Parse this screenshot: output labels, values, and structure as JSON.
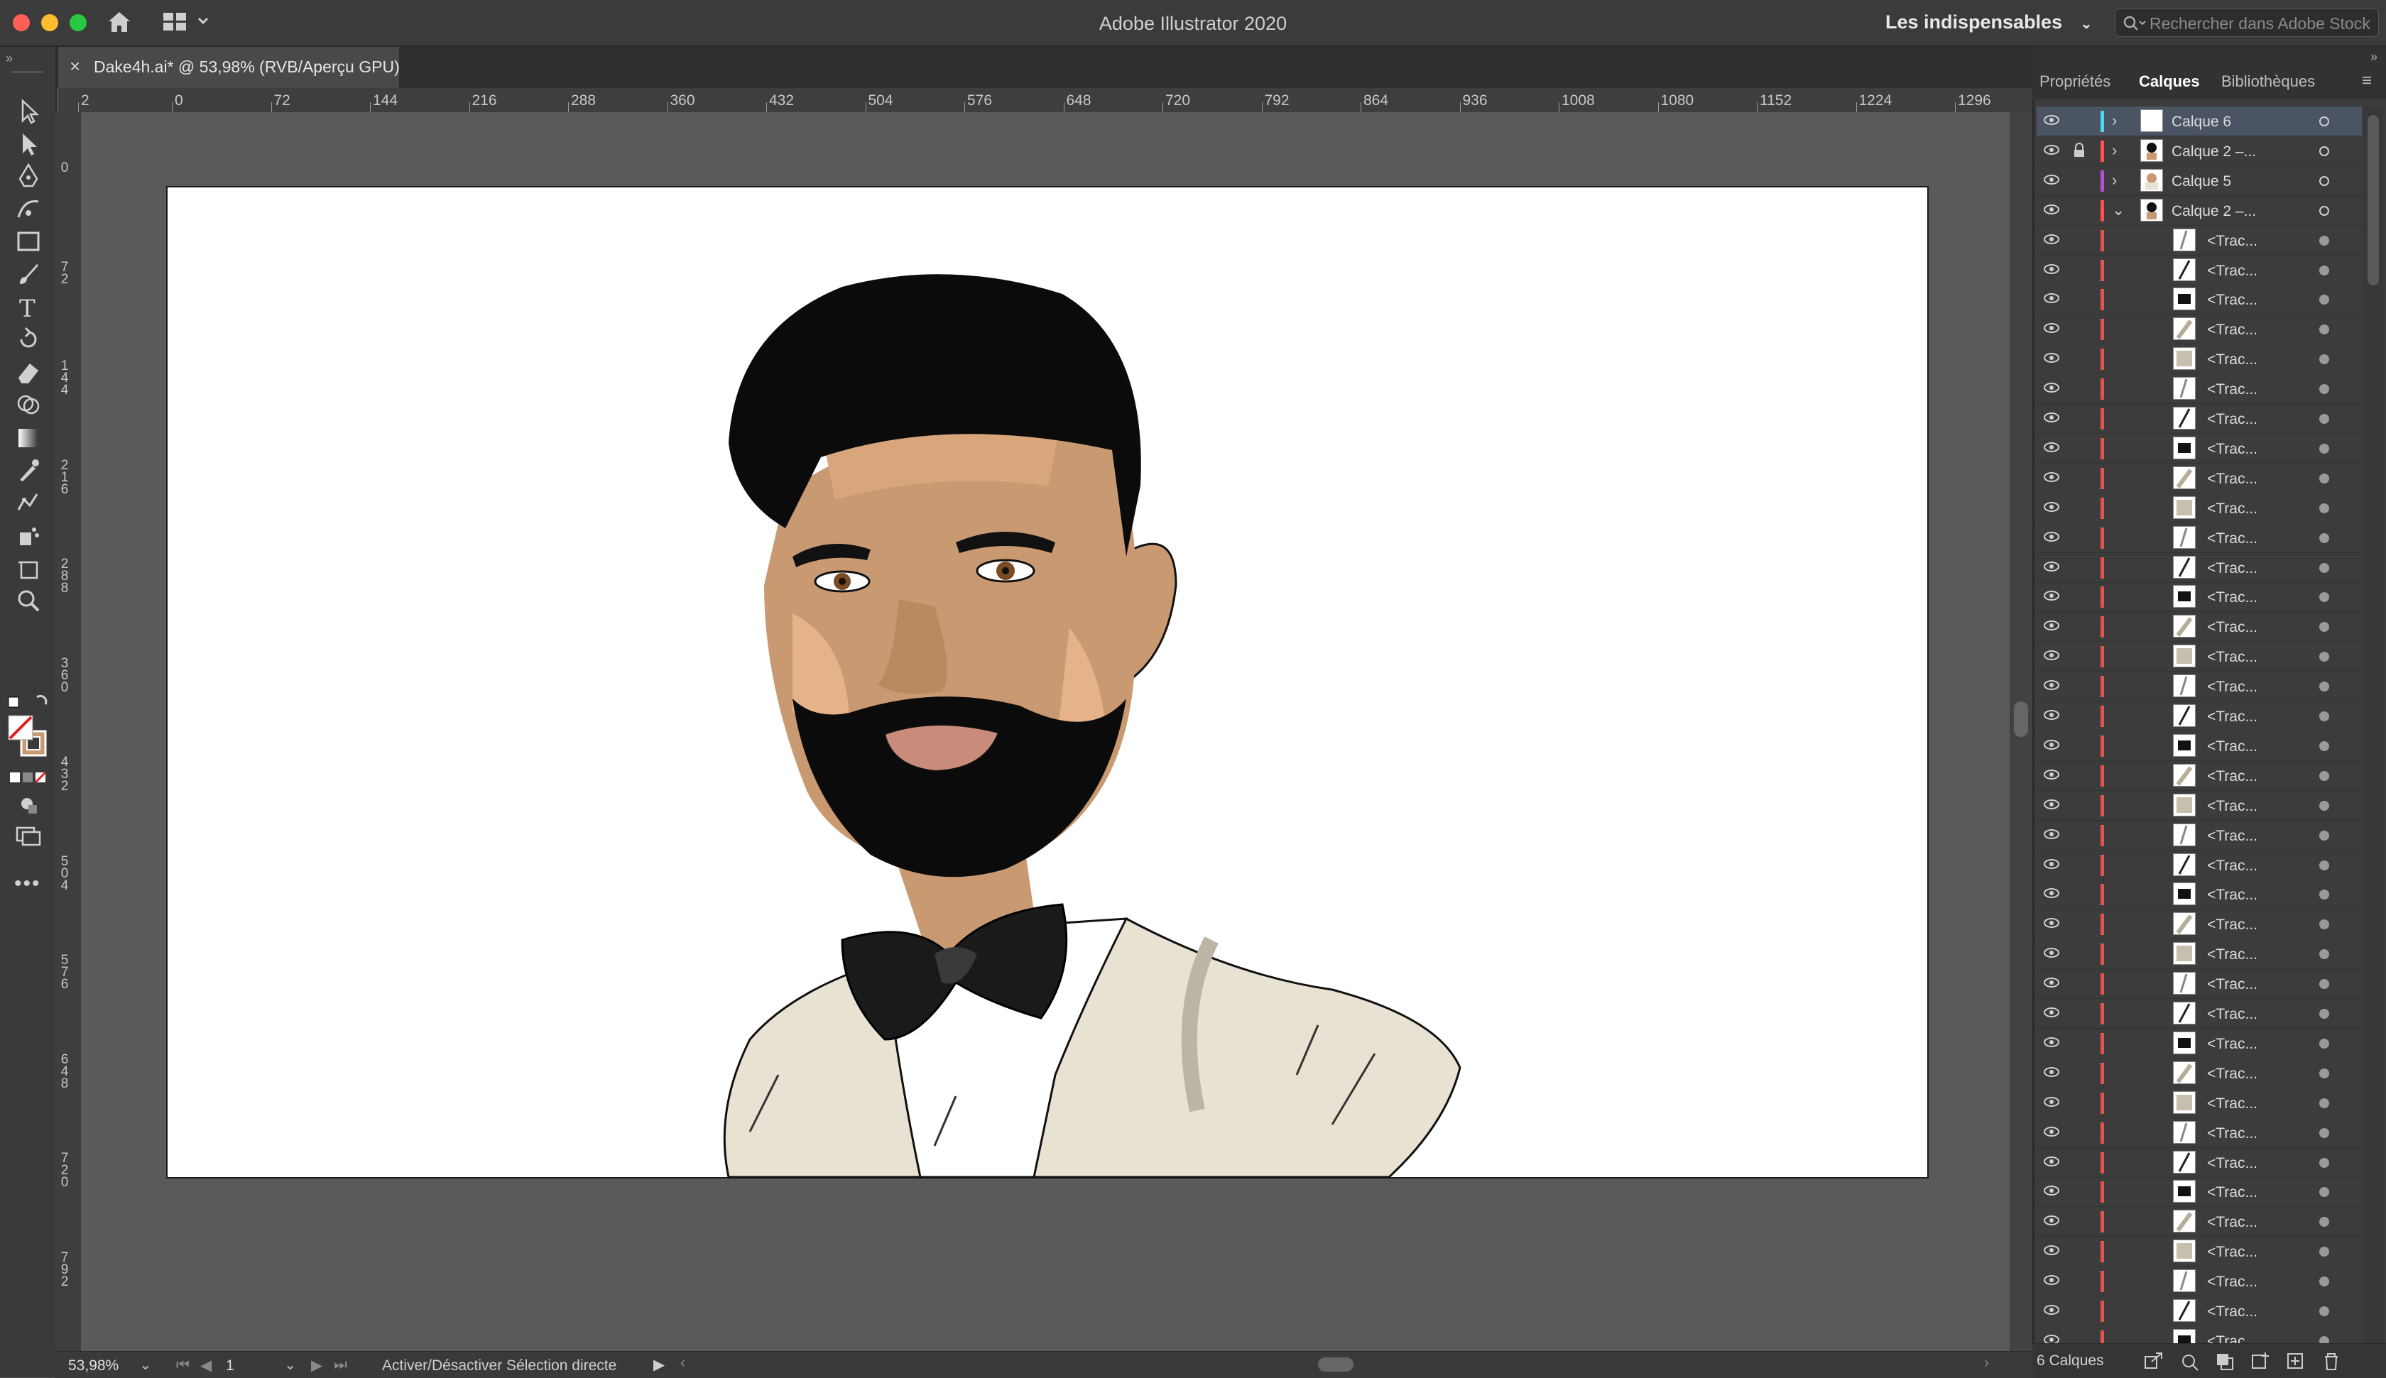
{
  "app": {
    "title": "Adobe Illustrator 2020",
    "workspace": "Les indispensables",
    "stock_search_placeholder": "Rechercher dans Adobe Stock"
  },
  "document": {
    "tab_label": "Dake4h.ai* @ 53,98% (RVB/Aperçu GPU)",
    "close_glyph": "×"
  },
  "rulers": {
    "horizontal": [
      "2",
      "0",
      "72",
      "144",
      "216",
      "288",
      "360",
      "432",
      "504",
      "576",
      "648",
      "720",
      "792",
      "864",
      "936",
      "1008",
      "1080",
      "1152",
      "1224",
      "1296"
    ],
    "vertical": [
      "0",
      "72",
      "144",
      "216",
      "288",
      "360",
      "432",
      "504",
      "576",
      "648",
      "720",
      "792"
    ]
  },
  "status": {
    "zoom": "53,98%",
    "artboard_number": "1",
    "message": "Activer/Désactiver Sélection directe"
  },
  "panel": {
    "tabs": [
      "Propriétés",
      "Calques",
      "Bibliothèques"
    ],
    "active_tab": "Calques",
    "layer_count": "6 Calques",
    "layers": [
      {
        "name": "Calque 6",
        "color": "#4fd3f1",
        "expand": "›",
        "selected": true
      },
      {
        "name": "Calque 2 –...",
        "color": "#ff4f4f",
        "expand": "›",
        "locked": true
      },
      {
        "name": "Calque 5",
        "color": "#b84fd6",
        "expand": "›"
      },
      {
        "name": "Calque 2 –...",
        "color": "#ff4f4f",
        "expand": "⌄"
      }
    ],
    "sublayer_label": "<Trac...",
    "sublayer_color": "#e0554f"
  },
  "colors": {
    "ui_bg": "#535353",
    "panel_bg": "#3c3c3c",
    "artboard": "#ffffff",
    "jacket": "#e8e2d2",
    "skin": "#c99a72",
    "hair": "#0b0b0b"
  }
}
